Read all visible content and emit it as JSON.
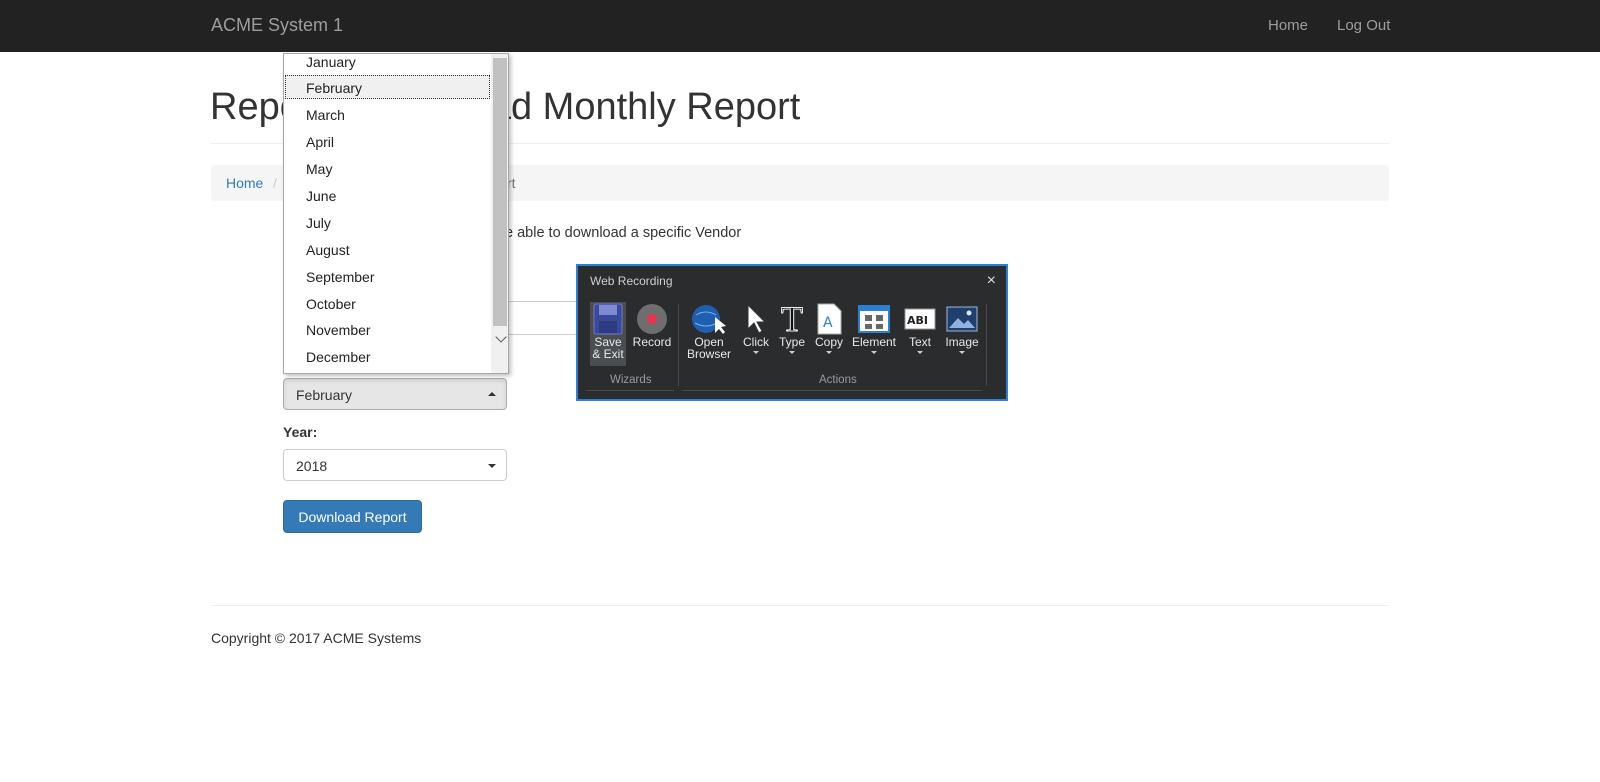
{
  "navbar": {
    "brand": "ACME System 1",
    "links": [
      "Home",
      "Log Out"
    ]
  },
  "page": {
    "title_visible_left": "Repo",
    "title_visible_right": "ad Monthly Report",
    "breadcrumb": {
      "home": "Home",
      "separator": "/",
      "current_visible": "rt"
    },
    "description_visible": "e able to download a specific Vendor"
  },
  "form": {
    "month_selected": "February",
    "year_label": "Year:",
    "year_selected": "2018",
    "download_button": "Download Report"
  },
  "dropdown": {
    "options": [
      "January",
      "February",
      "March",
      "April",
      "May",
      "June",
      "July",
      "August",
      "September",
      "October",
      "November",
      "December"
    ],
    "selected": "February"
  },
  "recorder": {
    "title": "Web Recording",
    "close": "×",
    "wizards_label": "Wizards",
    "actions_label": "Actions",
    "tools": {
      "save_line1": "Save",
      "save_line2": "& Exit",
      "record": "Record",
      "open_line1": "Open",
      "open_line2": "Browser",
      "click": "Click",
      "type": "Type",
      "copy": "Copy",
      "element": "Element",
      "text": "Text",
      "image": "Image"
    }
  },
  "footer": {
    "copyright": "Copyright © 2017 ACME Systems"
  },
  "colors": {
    "navbar": "#222222",
    "primary": "#337ab7",
    "recorder_border": "#2b7fd4",
    "record_dot": "#e8334a"
  }
}
